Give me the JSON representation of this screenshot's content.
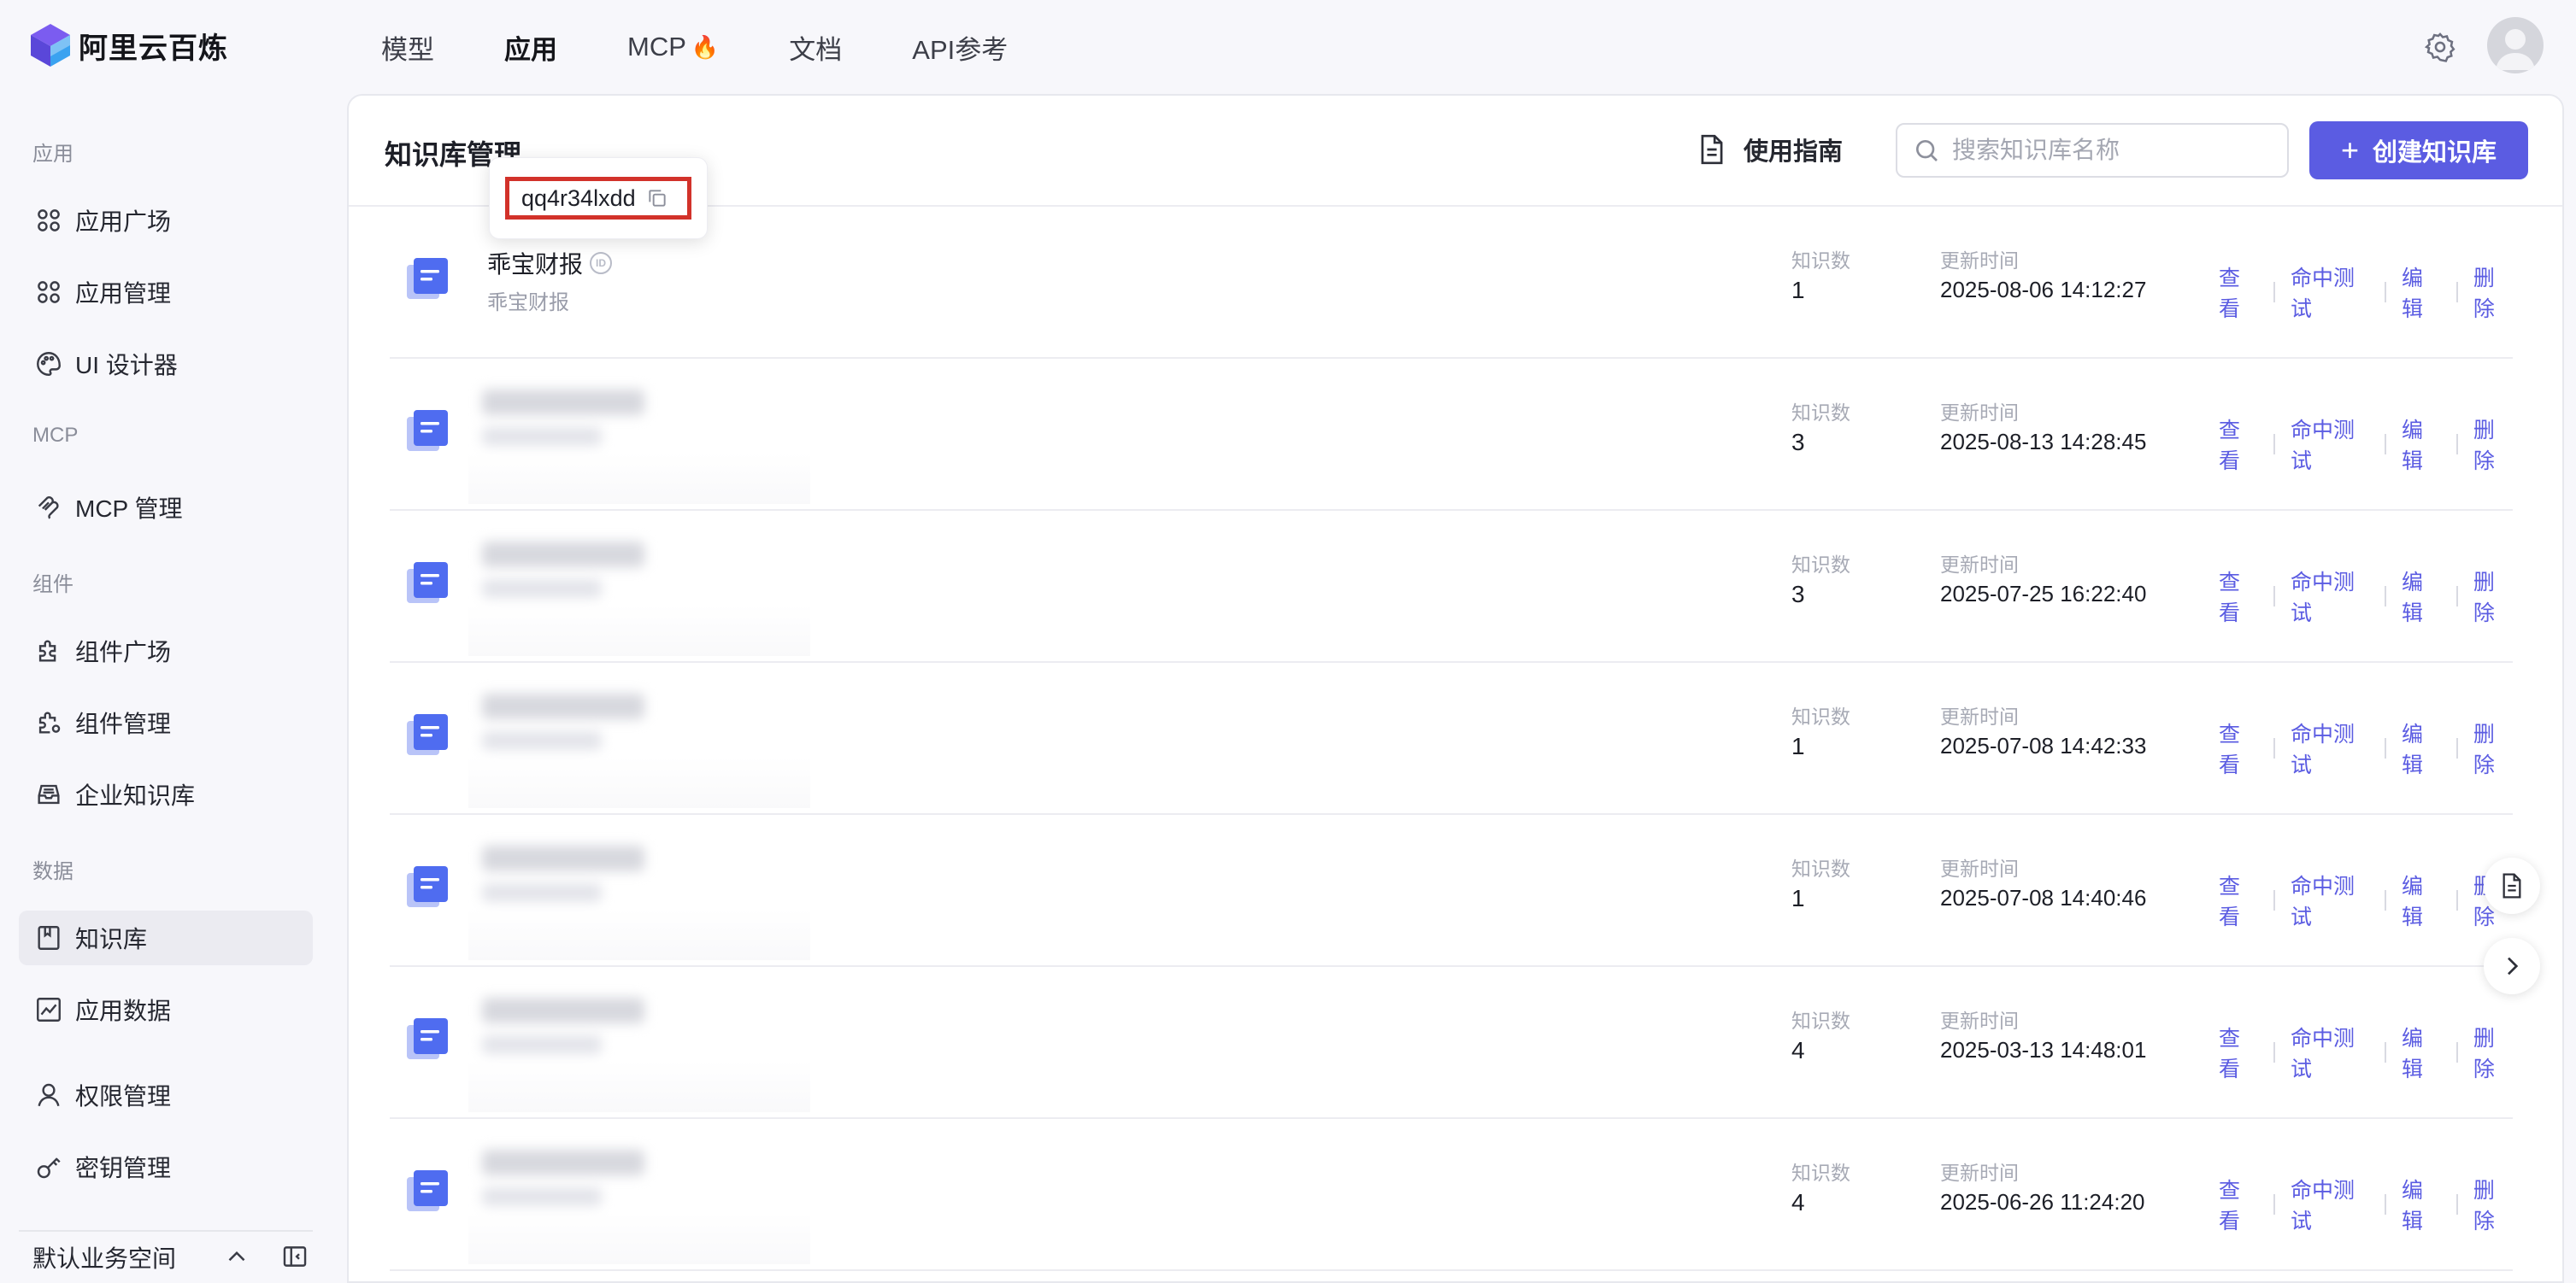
{
  "brand": {
    "name": "阿里云百炼"
  },
  "top_nav": {
    "items": [
      {
        "label": "模型"
      },
      {
        "label": "应用"
      },
      {
        "label": "MCP",
        "icon": "fire-icon"
      },
      {
        "label": "文档"
      },
      {
        "label": "API参考"
      }
    ],
    "active": "应用"
  },
  "sidebar": {
    "groups": {
      "apps": "应用",
      "mcp": "MCP",
      "components": "组件",
      "data": "数据"
    },
    "items": {
      "app_plaza": "应用广场",
      "app_manage": "应用管理",
      "ui_designer": "UI 设计器",
      "mcp_manage": "MCP 管理",
      "component_plaza": "组件广场",
      "component_manage": "组件管理",
      "enterprise_kb": "企业知识库",
      "knowledge_base": "知识库",
      "app_data": "应用数据",
      "permissions": "权限管理",
      "keys": "密钥管理"
    },
    "workspace": "默认业务空间"
  },
  "panel": {
    "title": "知识库管理",
    "guide_label": "使用指南",
    "search_placeholder": "搜索知识库名称",
    "create_label": "创建知识库"
  },
  "tooltip": {
    "id": "qq4r34lxdd"
  },
  "rows": [
    {
      "name": "乖宝财报",
      "sub": "乖宝财报",
      "count_label": "知识数",
      "count": "1",
      "time_label": "更新时间",
      "time": "2025-08-06 14:12:27"
    },
    {
      "name": "",
      "sub": "",
      "count_label": "知识数",
      "count": "3",
      "time_label": "更新时间",
      "time": "2025-08-13 14:28:45"
    },
    {
      "name": "",
      "sub": "",
      "count_label": "知识数",
      "count": "3",
      "time_label": "更新时间",
      "time": "2025-07-25 16:22:40"
    },
    {
      "name": "",
      "sub": "",
      "count_label": "知识数",
      "count": "1",
      "time_label": "更新时间",
      "time": "2025-07-08 14:42:33"
    },
    {
      "name": "",
      "sub": "",
      "count_label": "知识数",
      "count": "1",
      "time_label": "更新时间",
      "time": "2025-07-08 14:40:46"
    },
    {
      "name": "",
      "sub": "",
      "count_label": "知识数",
      "count": "4",
      "time_label": "更新时间",
      "time": "2025-03-13 14:48:01"
    },
    {
      "name": "",
      "sub": "",
      "count_label": "知识数",
      "count": "4",
      "time_label": "更新时间",
      "time": "2025-06-26 11:24:20"
    }
  ],
  "row_actions": [
    "查看",
    "命中测试",
    "编辑",
    "删除"
  ],
  "colors": {
    "accent": "#5b5ce2",
    "highlight_border": "#d2322a",
    "icon_blue": "#4f6cf0"
  }
}
